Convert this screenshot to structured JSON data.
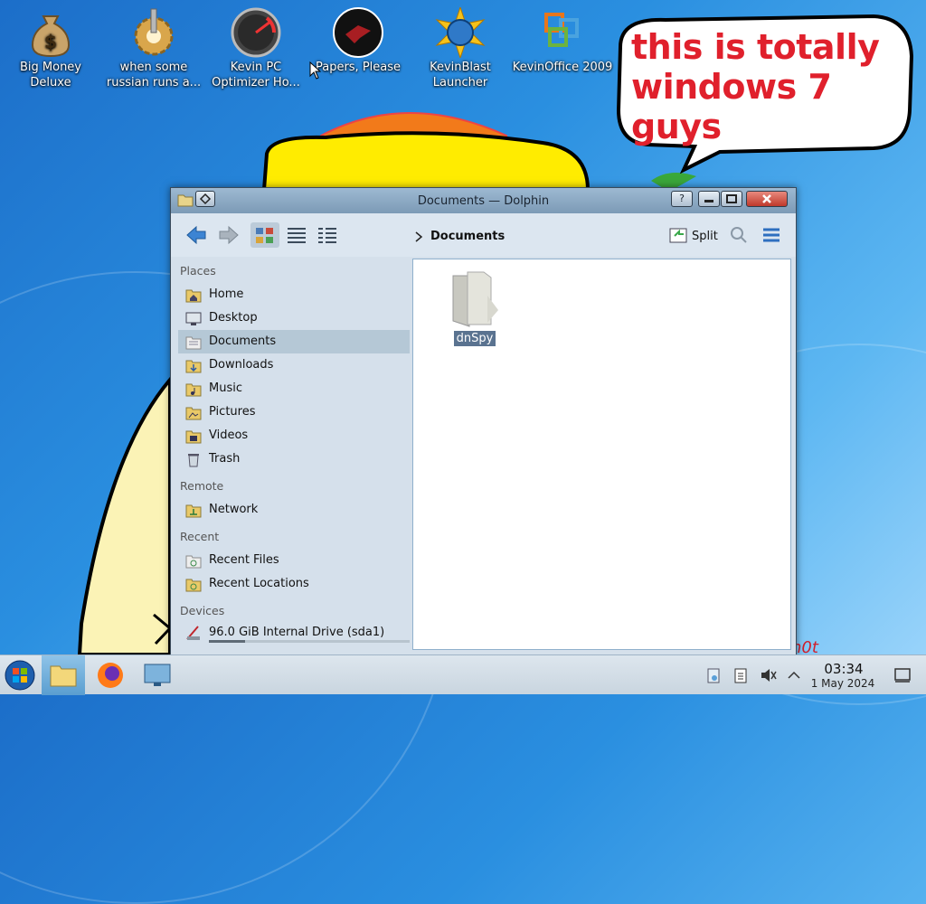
{
  "desktop": {
    "icons": [
      {
        "label": "Big Money Deluxe",
        "icon": "money-bag-icon"
      },
      {
        "label": "when some russian runs a...",
        "icon": "gear-icon"
      },
      {
        "label": "Kevin PC Optimizer Ho...",
        "icon": "gauge-icon"
      },
      {
        "label": "Papers, Please",
        "icon": "eagle-emblem-icon"
      },
      {
        "label": "KevinBlast Launcher",
        "icon": "blast-globe-icon"
      },
      {
        "label": "KevinOffice 2009",
        "icon": "office-logo-icon"
      }
    ],
    "bubble_line1": "this is totally",
    "bubble_line2": "windows 7 guys",
    "colors": {
      "bubble_text": "#e0202c",
      "desktop_blue": "#2a8fe0"
    }
  },
  "window": {
    "title": "Documents — Dolphin",
    "help_label": "?",
    "toolbar": {
      "breadcrumb": "Documents",
      "split_label": "Split"
    },
    "places": {
      "groups": [
        {
          "title": "Places",
          "items": [
            {
              "label": "Home",
              "icon": "home-folder-icon"
            },
            {
              "label": "Desktop",
              "icon": "desktop-icon"
            },
            {
              "label": "Documents",
              "icon": "documents-folder-icon",
              "active": true
            },
            {
              "label": "Downloads",
              "icon": "downloads-folder-icon"
            },
            {
              "label": "Music",
              "icon": "music-folder-icon"
            },
            {
              "label": "Pictures",
              "icon": "pictures-folder-icon"
            },
            {
              "label": "Videos",
              "icon": "videos-folder-icon"
            },
            {
              "label": "Trash",
              "icon": "trash-icon"
            }
          ]
        },
        {
          "title": "Remote",
          "items": [
            {
              "label": "Network",
              "icon": "network-folder-icon"
            }
          ]
        },
        {
          "title": "Recent",
          "items": [
            {
              "label": "Recent Files",
              "icon": "recent-files-icon"
            },
            {
              "label": "Recent Locations",
              "icon": "recent-locations-icon"
            }
          ]
        },
        {
          "title": "Devices",
          "items": [
            {
              "label": "96.0 GiB Internal Drive (sda1)",
              "icon": "drive-icon",
              "usage": 0.18
            }
          ]
        }
      ]
    },
    "files": [
      {
        "name": "dnSpy",
        "type": "folder",
        "selected": true
      }
    ]
  },
  "taskbar": {
    "clock_time": "03:34",
    "clock_date": "1 May 2024",
    "apps": [
      "start-orb-icon",
      "file-manager-icon",
      "firefox-icon",
      "system-settings-icon"
    ]
  }
}
